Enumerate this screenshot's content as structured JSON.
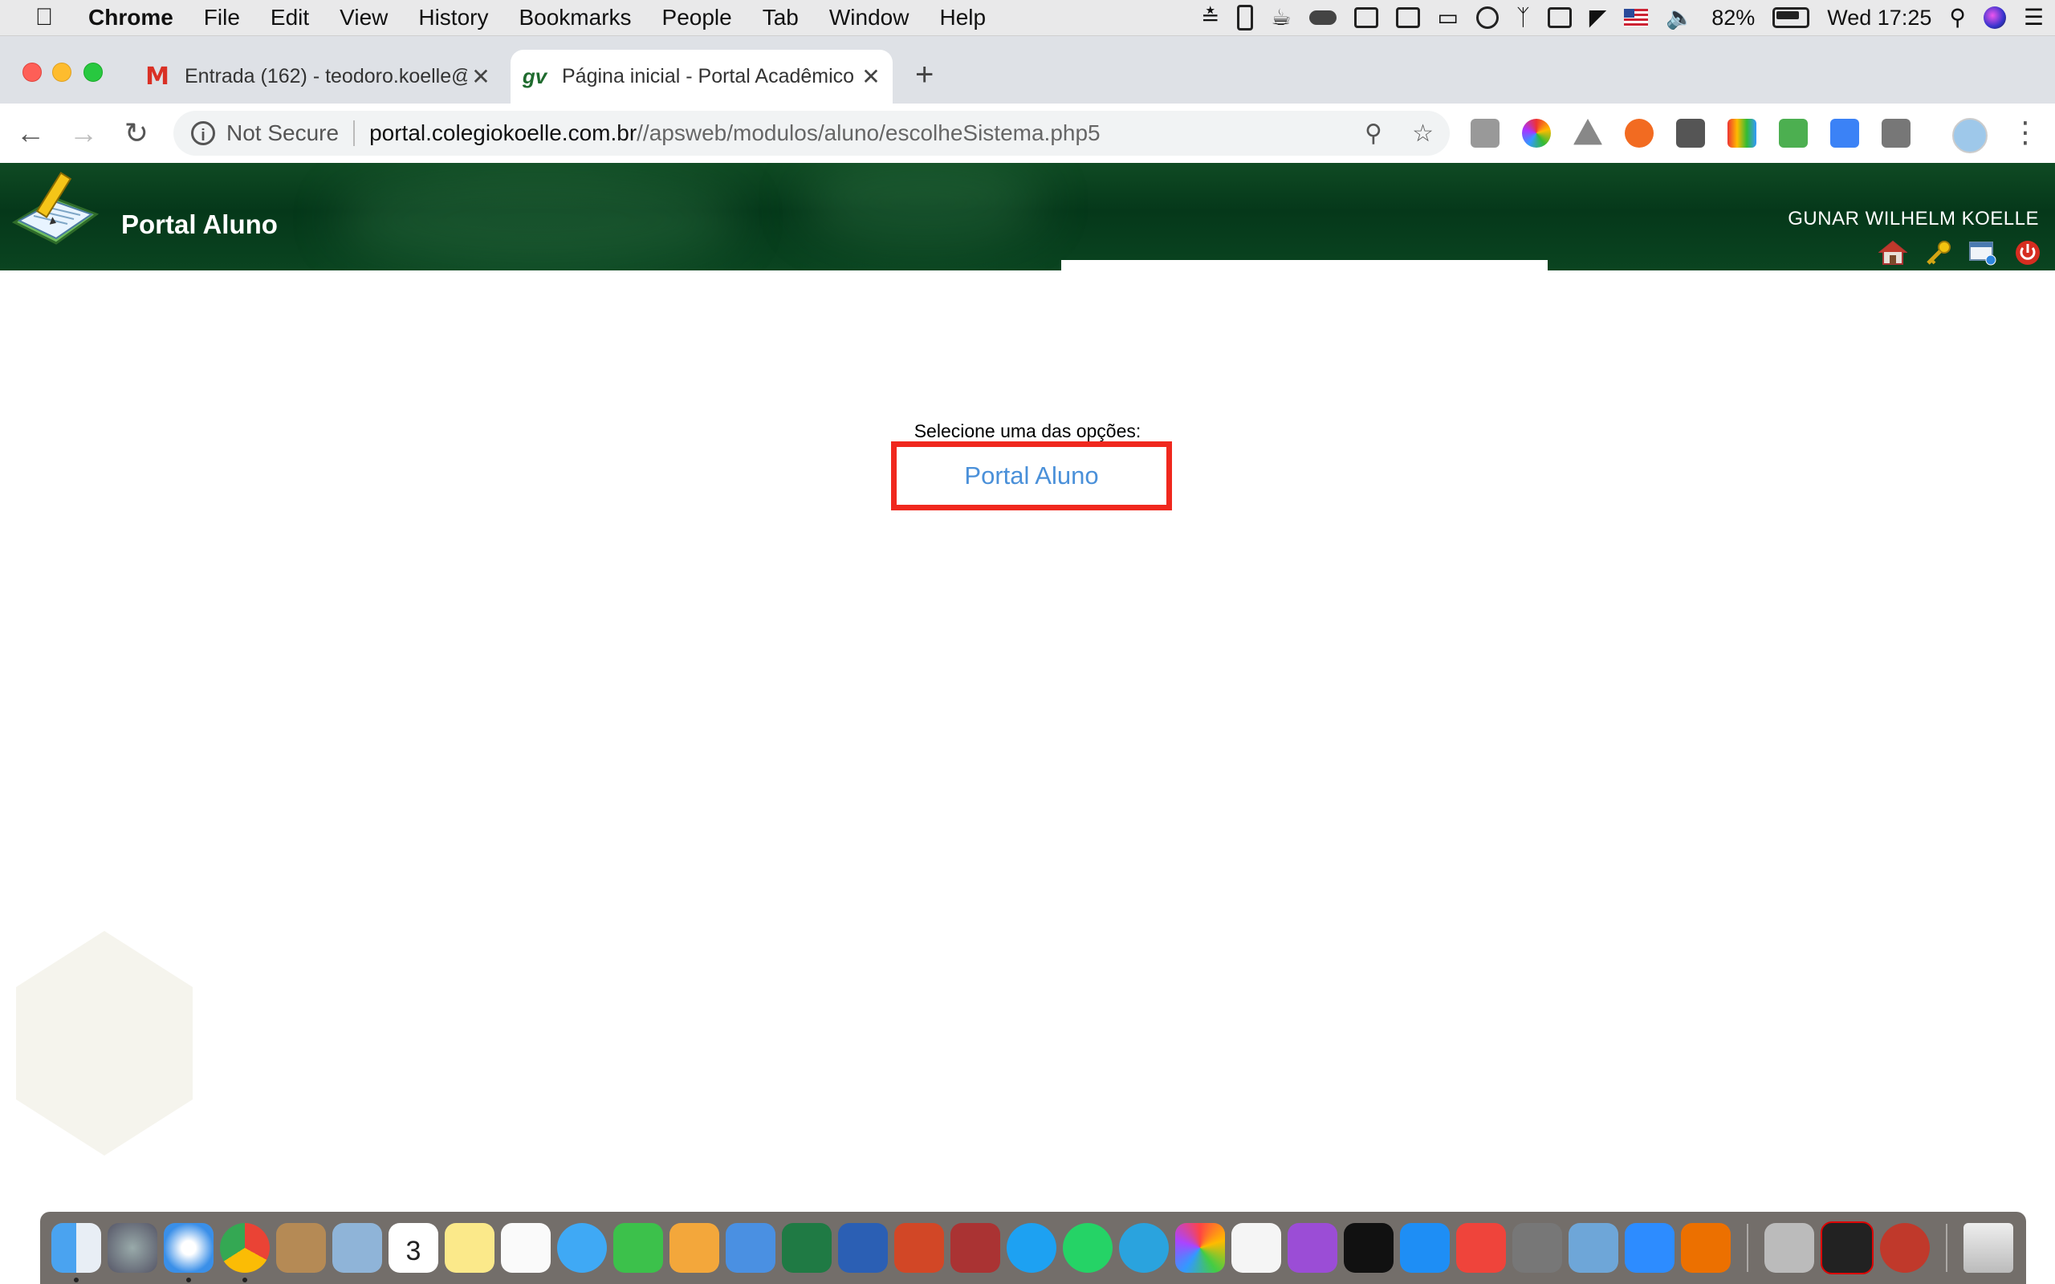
{
  "menubar": {
    "app_name": "Chrome",
    "items": [
      "File",
      "Edit",
      "View",
      "History",
      "Bookmarks",
      "People",
      "Tab",
      "Window",
      "Help"
    ],
    "battery_percent": "82%",
    "clock": "Wed 17:25"
  },
  "tabs": [
    {
      "title": "Entrada (162) - teodoro.koelle@",
      "favicon": "gmail-icon",
      "active": false
    },
    {
      "title": "Página inicial - Portal Acadêmico",
      "favicon": "gv-icon",
      "active": true
    }
  ],
  "toolbar": {
    "security_label": "Not Secure",
    "url_host": "portal.colegiokoelle.com.br",
    "url_path": "//apsweb/modulos/aluno/escolheSistema.php5"
  },
  "header": {
    "portal_title": "Portal Aluno",
    "user_name": "GUNAR WILHELM KOELLE"
  },
  "main": {
    "prompt": "Selecione uma das opções:",
    "option_label": "Portal Aluno"
  },
  "colors": {
    "header_green": "#05381a",
    "highlight_red": "#f0281e",
    "link_blue": "#4a90d9"
  },
  "dock_apps": [
    "finder",
    "launchpad",
    "safari",
    "chrome",
    "contacts",
    "mail",
    "calendar",
    "notes",
    "reminders",
    "messages",
    "facetime",
    "pages",
    "keynote",
    "excel",
    "word",
    "powerpoint",
    "photo-booth",
    "skype",
    "whatsapp",
    "telegram",
    "photos",
    "music",
    "podcasts",
    "apple-tv",
    "app-store",
    "anydesk",
    "system-preferences",
    "preview",
    "zoom",
    "itau",
    "keychain",
    "acrobat",
    "outlook-badge",
    "trash"
  ],
  "calendar_day": "3"
}
